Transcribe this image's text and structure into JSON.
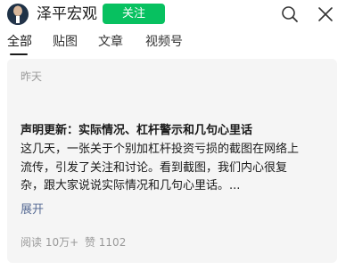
{
  "header": {
    "account_name": "泽平宏观",
    "follow_label": "关注"
  },
  "tabs": [
    {
      "label": "全部",
      "active": true
    },
    {
      "label": "贴图",
      "active": false
    },
    {
      "label": "文章",
      "active": false
    },
    {
      "label": "视频号",
      "active": false
    }
  ],
  "article": {
    "date": "昨天",
    "title": "声明更新：实际情况、杠杆警示和几句心里话",
    "excerpt_lines": [
      "这几天，一张关于个别加杠杆投资亏损的截图在网络上",
      "流传，引发了关注和讨论。看到截图，我们内心很复",
      "杂，跟大家说说实际情况和几句心里话。..."
    ],
    "expand_label": "展开",
    "reads": "阅读 10万+",
    "likes": "赞 1102"
  },
  "colors": {
    "accent_green": "#07c160",
    "link_blue": "#576b95",
    "muted_gray": "#9a9a9a",
    "card_bg": "#f5f5f5"
  },
  "icons": {
    "search": "search-icon",
    "close": "close-icon",
    "avatar": "avatar"
  }
}
